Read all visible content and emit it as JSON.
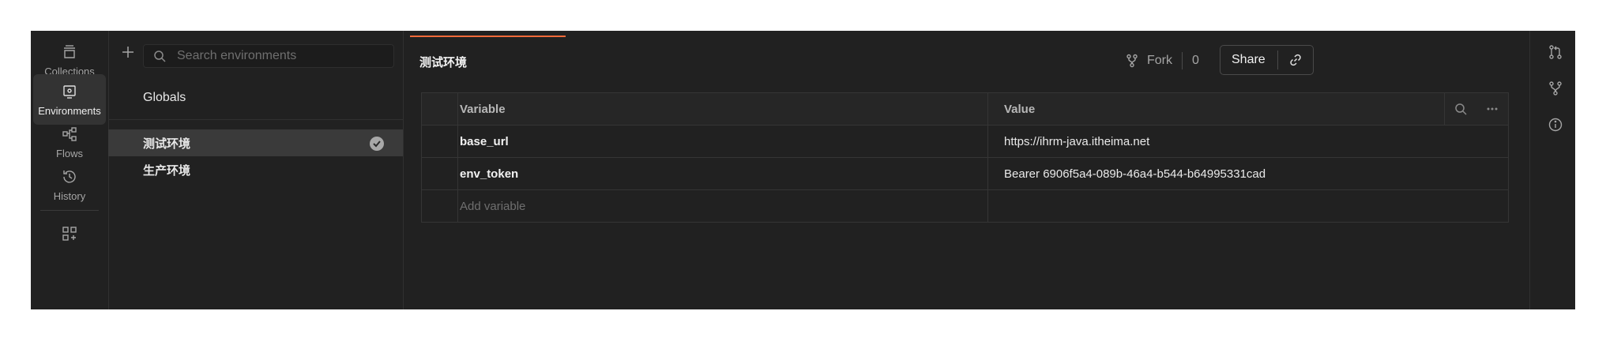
{
  "rail": {
    "items": [
      {
        "label": "Collections",
        "icon": "collections-icon"
      },
      {
        "label": "Environments",
        "icon": "environments-icon"
      },
      {
        "label": "Flows",
        "icon": "flows-icon"
      },
      {
        "label": "History",
        "icon": "history-icon"
      }
    ],
    "more_icon": "add-workspace-icon"
  },
  "environments": {
    "search_placeholder": "Search environments",
    "globals_label": "Globals",
    "items": [
      {
        "name": "测试环境",
        "active": true
      },
      {
        "name": "生产环境",
        "active": false
      }
    ]
  },
  "main": {
    "title": "测试环境",
    "fork_label": "Fork",
    "fork_count": "0",
    "share_label": "Share",
    "table": {
      "headers": [
        "Variable",
        "Value"
      ],
      "rows": [
        {
          "variable": "base_url",
          "value": "https://ihrm-java.itheima.net"
        },
        {
          "variable": "env_token",
          "value": "Bearer 6906f5a4-089b-46a4-b544-b64995331cad"
        }
      ],
      "add_placeholder": "Add variable"
    }
  },
  "colors": {
    "background": "#212121",
    "accent": "#f06a3a",
    "active_row": "#3a3a3a"
  }
}
